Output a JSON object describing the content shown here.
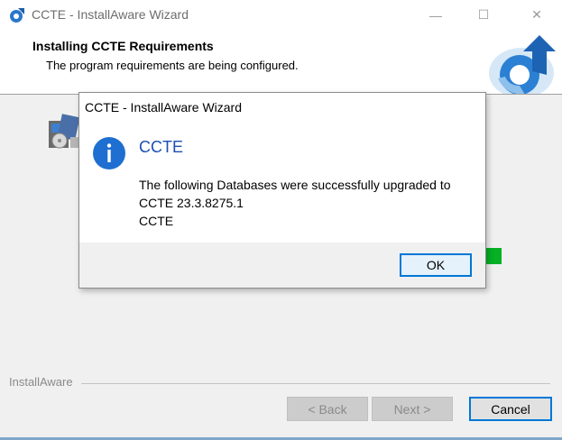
{
  "window": {
    "title": "CCTE - InstallAware Wizard",
    "controls": {
      "minimize": "—",
      "maximize": "☐",
      "close": "✕"
    }
  },
  "header": {
    "title": "Installing CCTE Requirements",
    "subtitle": "The program requirements are being configured."
  },
  "footer": {
    "brand_label": "InstallAware",
    "back_label": "< Back",
    "next_label": "Next >",
    "cancel_label": "Cancel"
  },
  "progress": {
    "visible_fill_color": "#06b025"
  },
  "dialog": {
    "title": "CCTE - InstallAware Wizard",
    "heading": "CCTE",
    "message_lines": [
      "The following Databases were successfully upgraded to",
      "CCTE 23.3.8275.1",
      "CCTE"
    ],
    "ok_label": "OK",
    "icon": "info-icon"
  },
  "colors": {
    "accent": "#0078d7",
    "dialog_heading": "#1c4fb4",
    "info_icon": "#1e6fd1"
  }
}
